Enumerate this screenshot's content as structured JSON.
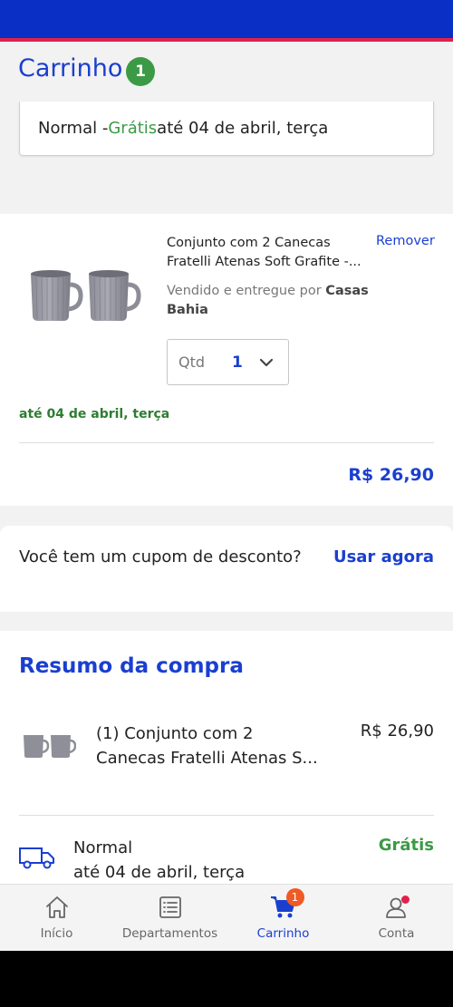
{
  "header": {
    "title": "Carrinho",
    "item_count": "1",
    "colors": {
      "primary": "#0a2fc4",
      "accent_stripe": "#e0214d",
      "success": "#3c9a46"
    }
  },
  "shipping_option": {
    "method": "Normal - ",
    "cost": "Grátis",
    "date": " até 04 de abril, terça"
  },
  "cart_item": {
    "name": "Conjunto com 2 Canecas Fratelli Atenas Soft Grafite -...",
    "remove_label": "Remover",
    "seller_prefix": "Vendido e entregue por ",
    "seller_name": "Casas Bahia",
    "qty_label": "Qtd",
    "qty_value": "1",
    "delivery_date": "até 04 de abril, terça",
    "price": "R$ 26,90",
    "image_icon": "gray-mugs-image"
  },
  "coupon": {
    "question": "Você tem um cupom de desconto?",
    "action_label": "Usar agora"
  },
  "summary": {
    "title": "Resumo da compra",
    "item_line_1": "(1) Conjunto com 2",
    "item_line_2": "Canecas Fratelli Atenas S...",
    "item_price": "R$ 26,90",
    "shipping_method": "Normal",
    "shipping_date": "até 04 de abril, terça",
    "shipping_cost": "Grátis",
    "shipping_icon": "truck-icon"
  },
  "bottom_nav": {
    "items": [
      {
        "label": "Início",
        "icon": "home-icon"
      },
      {
        "label": "Departamentos",
        "icon": "list-icon"
      },
      {
        "label": "Carrinho",
        "icon": "cart-icon",
        "badge": "1",
        "active": true
      },
      {
        "label": "Conta",
        "icon": "user-icon"
      }
    ]
  }
}
